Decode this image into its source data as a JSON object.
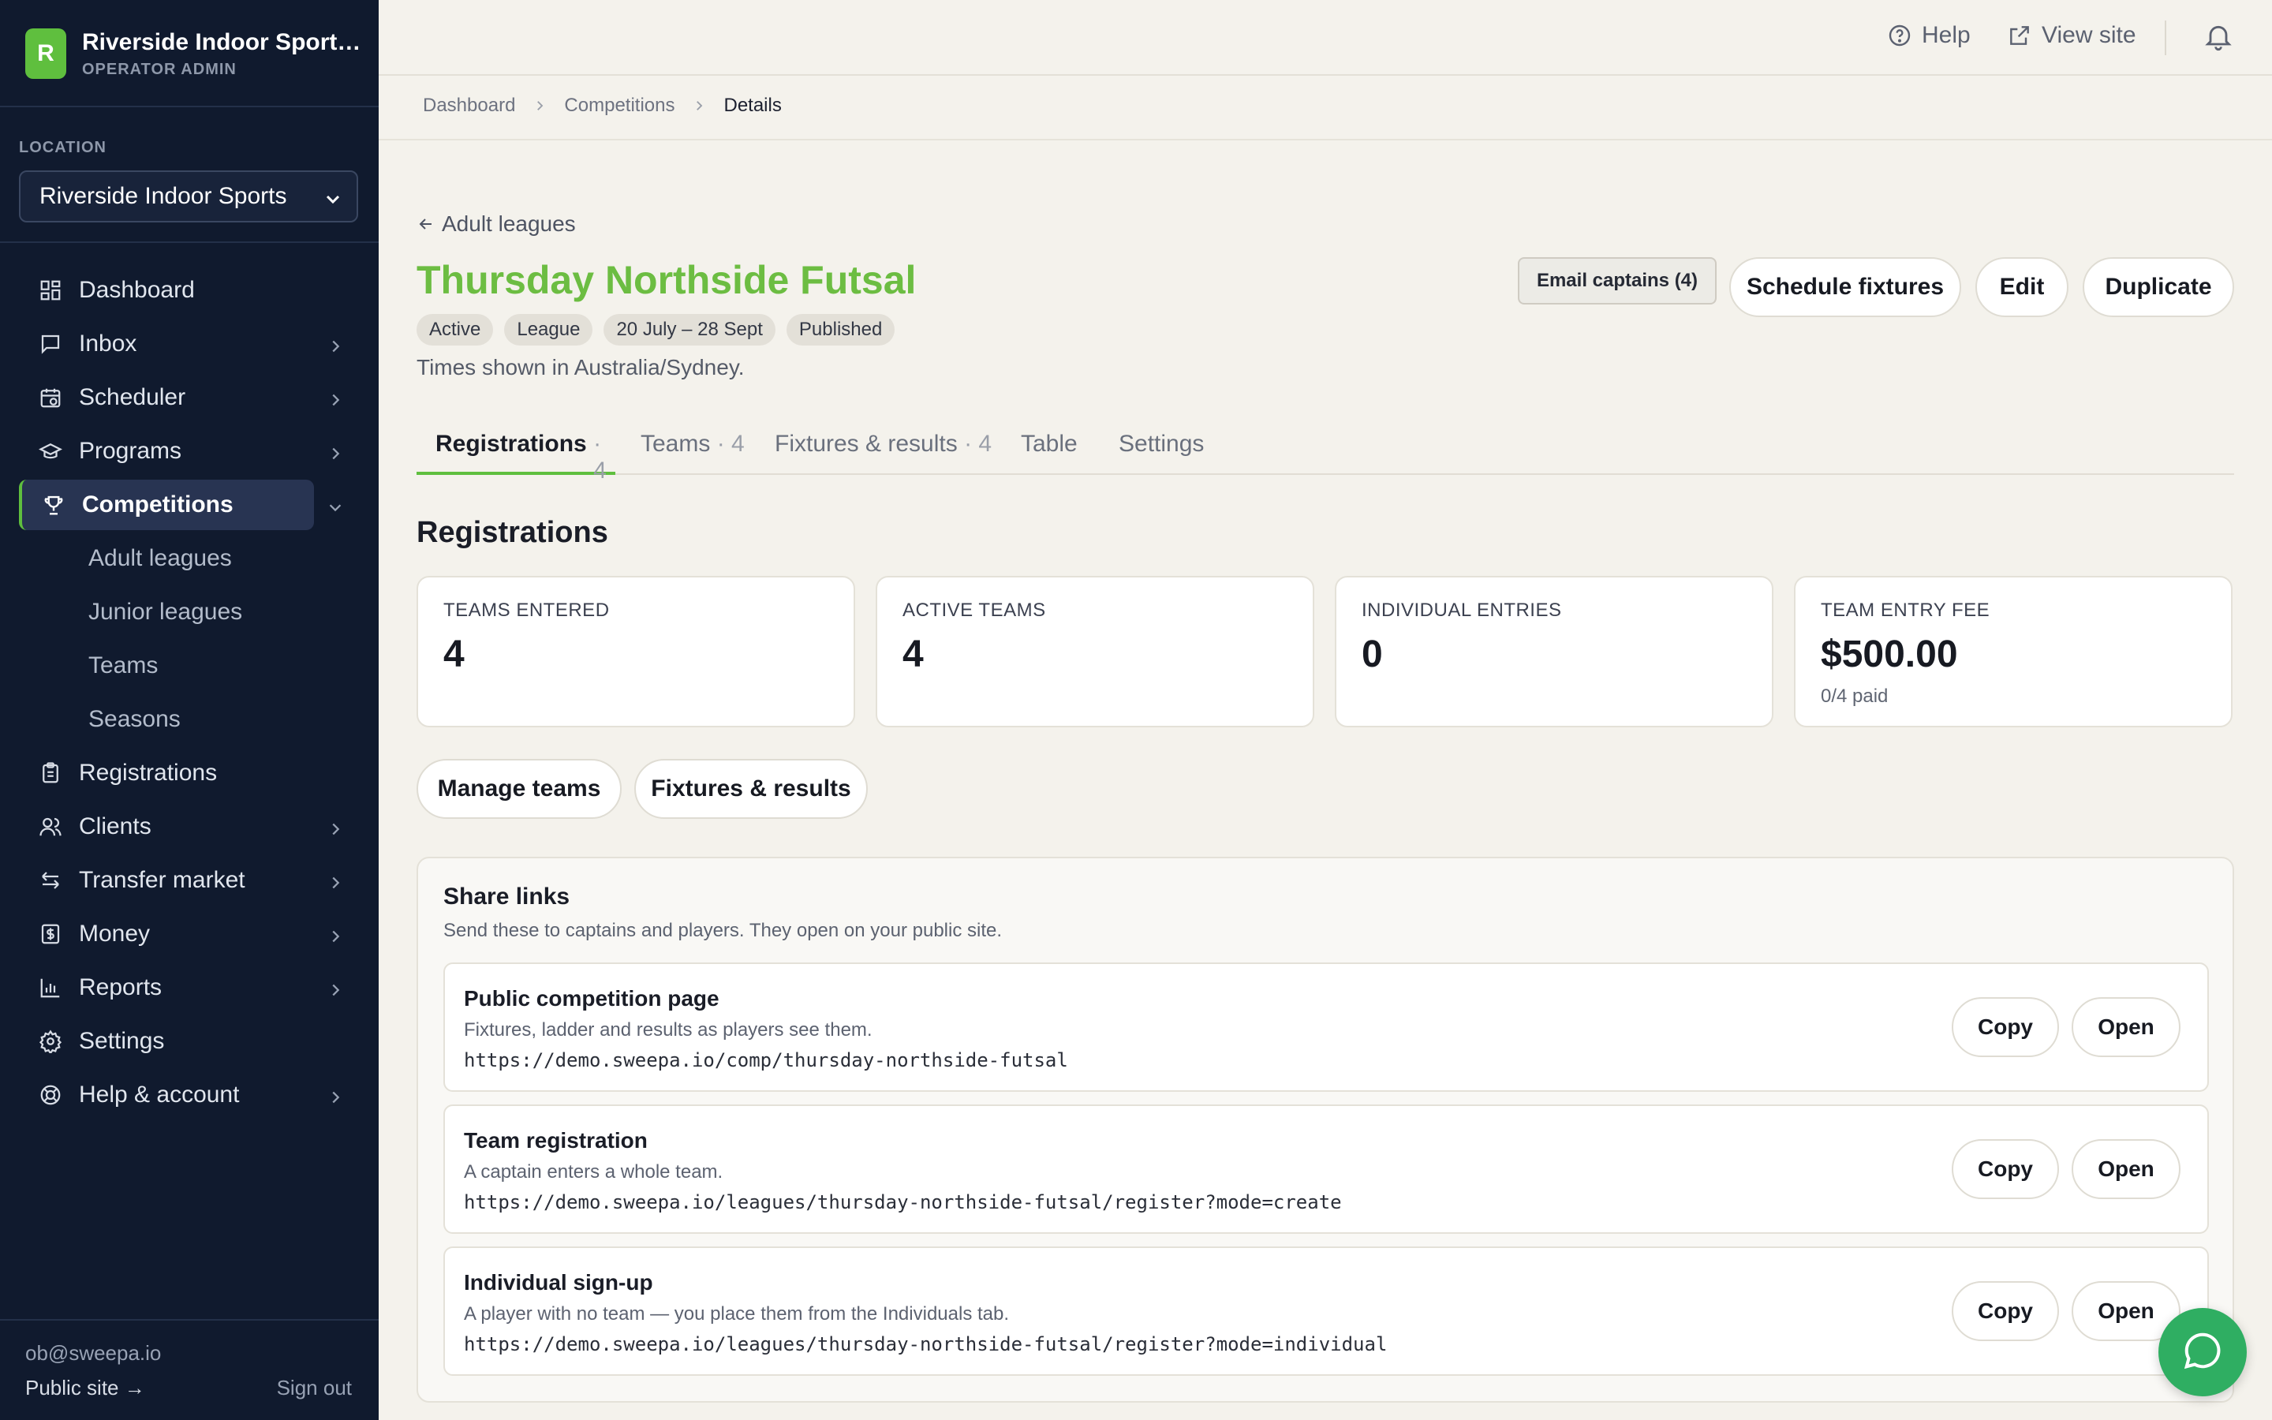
{
  "brand": {
    "initial": "R",
    "name": "Riverside Indoor Sports ...",
    "subtitle": "OPERATOR ADMIN",
    "logo_color": "#5fbf3e"
  },
  "location": {
    "label": "LOCATION",
    "selected": "Riverside Indoor Sports"
  },
  "nav": {
    "dashboard": "Dashboard",
    "inbox": "Inbox",
    "scheduler": "Scheduler",
    "programs": "Programs",
    "competitions": "Competitions",
    "competitions_sub": [
      "Adult leagues",
      "Junior leagues",
      "Teams",
      "Seasons"
    ],
    "registrations": "Registrations",
    "clients": "Clients",
    "transfer_market": "Transfer market",
    "money": "Money",
    "reports": "Reports",
    "settings": "Settings",
    "help_account": "Help & account"
  },
  "sidebar_footer": {
    "email": "ob@sweepa.io",
    "public_site": "Public site →",
    "sign_out": "Sign out"
  },
  "topbar": {
    "help": "Help",
    "view_site": "View site"
  },
  "breadcrumb": [
    "Dashboard",
    "Competitions",
    "Details"
  ],
  "header": {
    "back_link": "Adult leagues",
    "title": "Thursday Northside Futsal",
    "title_color": "#6cbd42",
    "badges": [
      "Active",
      "League",
      "20 July – 28 Sept",
      "Published"
    ],
    "timezone_note": "Times shown in Australia/Sydney.",
    "email_captains": "Email captains (4)",
    "schedule_fixtures": "Schedule fixtures",
    "edit": "Edit",
    "duplicate": "Duplicate"
  },
  "tabs": [
    {
      "label": "Registrations",
      "count": "· 4",
      "active": true
    },
    {
      "label": "Teams",
      "count": "· 4"
    },
    {
      "label": "Fixtures & results",
      "count": "· 4"
    },
    {
      "label": "Table",
      "count": ""
    },
    {
      "label": "Settings",
      "count": ""
    }
  ],
  "registrations": {
    "title": "Registrations",
    "stats": [
      {
        "label": "TEAMS ENTERED",
        "value": "4"
      },
      {
        "label": "ACTIVE TEAMS",
        "value": "4"
      },
      {
        "label": "INDIVIDUAL ENTRIES",
        "value": "0"
      },
      {
        "label": "TEAM ENTRY FEE",
        "value": "$500.00",
        "sub": "0/4 paid"
      }
    ],
    "manage_teams": "Manage teams",
    "fixtures_results": "Fixtures & results"
  },
  "share": {
    "title": "Share links",
    "description": "Send these to captains and players. They open on your public site.",
    "copy_label": "Copy",
    "open_label": "Open",
    "links": [
      {
        "title": "Public competition page",
        "description": "Fixtures, ladder and results as players see them.",
        "url": "https://demo.sweepa.io/comp/thursday-northside-futsal"
      },
      {
        "title": "Team registration",
        "description": "A captain enters a whole team.",
        "url": "https://demo.sweepa.io/leagues/thursday-northside-futsal/register?mode=create"
      },
      {
        "title": "Individual sign-up",
        "description": "A player with no team — you place them from the Individuals tab.",
        "url": "https://demo.sweepa.io/leagues/thursday-northside-futsal/register?mode=individual"
      }
    ]
  },
  "colors": {
    "sidebar_bg": "#101a2e",
    "accent": "#5fbf3e",
    "chat_button": "#2fae62"
  },
  "icons": [
    "dashboard-icon",
    "inbox-icon",
    "scheduler-icon",
    "programs-icon",
    "trophy-icon",
    "clipboard-icon",
    "clients-icon",
    "transfer-icon",
    "money-icon",
    "reports-icon",
    "gear-icon",
    "lifebuoy-icon",
    "help-icon",
    "external-link-icon",
    "bell-icon",
    "chat-icon"
  ]
}
